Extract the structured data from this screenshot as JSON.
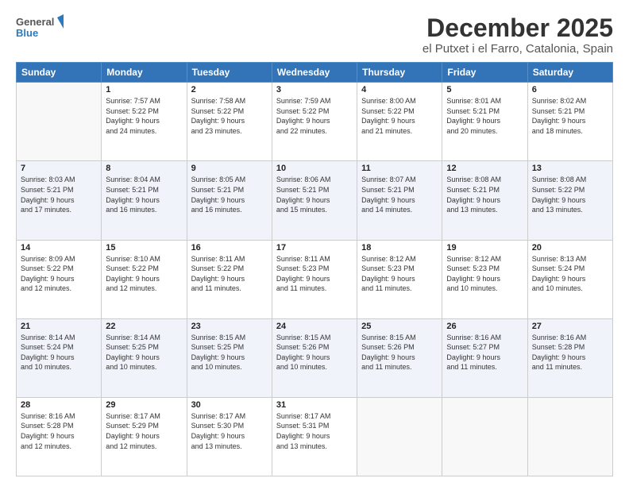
{
  "logo": {
    "line1": "General",
    "line2": "Blue"
  },
  "title": "December 2025",
  "subtitle": "el Putxet i el Farro, Catalonia, Spain",
  "weekdays": [
    "Sunday",
    "Monday",
    "Tuesday",
    "Wednesday",
    "Thursday",
    "Friday",
    "Saturday"
  ],
  "weeks": [
    [
      {
        "day": "",
        "info": ""
      },
      {
        "day": "1",
        "info": "Sunrise: 7:57 AM\nSunset: 5:22 PM\nDaylight: 9 hours\nand 24 minutes."
      },
      {
        "day": "2",
        "info": "Sunrise: 7:58 AM\nSunset: 5:22 PM\nDaylight: 9 hours\nand 23 minutes."
      },
      {
        "day": "3",
        "info": "Sunrise: 7:59 AM\nSunset: 5:22 PM\nDaylight: 9 hours\nand 22 minutes."
      },
      {
        "day": "4",
        "info": "Sunrise: 8:00 AM\nSunset: 5:22 PM\nDaylight: 9 hours\nand 21 minutes."
      },
      {
        "day": "5",
        "info": "Sunrise: 8:01 AM\nSunset: 5:21 PM\nDaylight: 9 hours\nand 20 minutes."
      },
      {
        "day": "6",
        "info": "Sunrise: 8:02 AM\nSunset: 5:21 PM\nDaylight: 9 hours\nand 18 minutes."
      }
    ],
    [
      {
        "day": "7",
        "info": "Sunrise: 8:03 AM\nSunset: 5:21 PM\nDaylight: 9 hours\nand 17 minutes."
      },
      {
        "day": "8",
        "info": "Sunrise: 8:04 AM\nSunset: 5:21 PM\nDaylight: 9 hours\nand 16 minutes."
      },
      {
        "day": "9",
        "info": "Sunrise: 8:05 AM\nSunset: 5:21 PM\nDaylight: 9 hours\nand 16 minutes."
      },
      {
        "day": "10",
        "info": "Sunrise: 8:06 AM\nSunset: 5:21 PM\nDaylight: 9 hours\nand 15 minutes."
      },
      {
        "day": "11",
        "info": "Sunrise: 8:07 AM\nSunset: 5:21 PM\nDaylight: 9 hours\nand 14 minutes."
      },
      {
        "day": "12",
        "info": "Sunrise: 8:08 AM\nSunset: 5:21 PM\nDaylight: 9 hours\nand 13 minutes."
      },
      {
        "day": "13",
        "info": "Sunrise: 8:08 AM\nSunset: 5:22 PM\nDaylight: 9 hours\nand 13 minutes."
      }
    ],
    [
      {
        "day": "14",
        "info": "Sunrise: 8:09 AM\nSunset: 5:22 PM\nDaylight: 9 hours\nand 12 minutes."
      },
      {
        "day": "15",
        "info": "Sunrise: 8:10 AM\nSunset: 5:22 PM\nDaylight: 9 hours\nand 12 minutes."
      },
      {
        "day": "16",
        "info": "Sunrise: 8:11 AM\nSunset: 5:22 PM\nDaylight: 9 hours\nand 11 minutes."
      },
      {
        "day": "17",
        "info": "Sunrise: 8:11 AM\nSunset: 5:23 PM\nDaylight: 9 hours\nand 11 minutes."
      },
      {
        "day": "18",
        "info": "Sunrise: 8:12 AM\nSunset: 5:23 PM\nDaylight: 9 hours\nand 11 minutes."
      },
      {
        "day": "19",
        "info": "Sunrise: 8:12 AM\nSunset: 5:23 PM\nDaylight: 9 hours\nand 10 minutes."
      },
      {
        "day": "20",
        "info": "Sunrise: 8:13 AM\nSunset: 5:24 PM\nDaylight: 9 hours\nand 10 minutes."
      }
    ],
    [
      {
        "day": "21",
        "info": "Sunrise: 8:14 AM\nSunset: 5:24 PM\nDaylight: 9 hours\nand 10 minutes."
      },
      {
        "day": "22",
        "info": "Sunrise: 8:14 AM\nSunset: 5:25 PM\nDaylight: 9 hours\nand 10 minutes."
      },
      {
        "day": "23",
        "info": "Sunrise: 8:15 AM\nSunset: 5:25 PM\nDaylight: 9 hours\nand 10 minutes."
      },
      {
        "day": "24",
        "info": "Sunrise: 8:15 AM\nSunset: 5:26 PM\nDaylight: 9 hours\nand 10 minutes."
      },
      {
        "day": "25",
        "info": "Sunrise: 8:15 AM\nSunset: 5:26 PM\nDaylight: 9 hours\nand 11 minutes."
      },
      {
        "day": "26",
        "info": "Sunrise: 8:16 AM\nSunset: 5:27 PM\nDaylight: 9 hours\nand 11 minutes."
      },
      {
        "day": "27",
        "info": "Sunrise: 8:16 AM\nSunset: 5:28 PM\nDaylight: 9 hours\nand 11 minutes."
      }
    ],
    [
      {
        "day": "28",
        "info": "Sunrise: 8:16 AM\nSunset: 5:28 PM\nDaylight: 9 hours\nand 12 minutes."
      },
      {
        "day": "29",
        "info": "Sunrise: 8:17 AM\nSunset: 5:29 PM\nDaylight: 9 hours\nand 12 minutes."
      },
      {
        "day": "30",
        "info": "Sunrise: 8:17 AM\nSunset: 5:30 PM\nDaylight: 9 hours\nand 13 minutes."
      },
      {
        "day": "31",
        "info": "Sunrise: 8:17 AM\nSunset: 5:31 PM\nDaylight: 9 hours\nand 13 minutes."
      },
      {
        "day": "",
        "info": ""
      },
      {
        "day": "",
        "info": ""
      },
      {
        "day": "",
        "info": ""
      }
    ]
  ]
}
